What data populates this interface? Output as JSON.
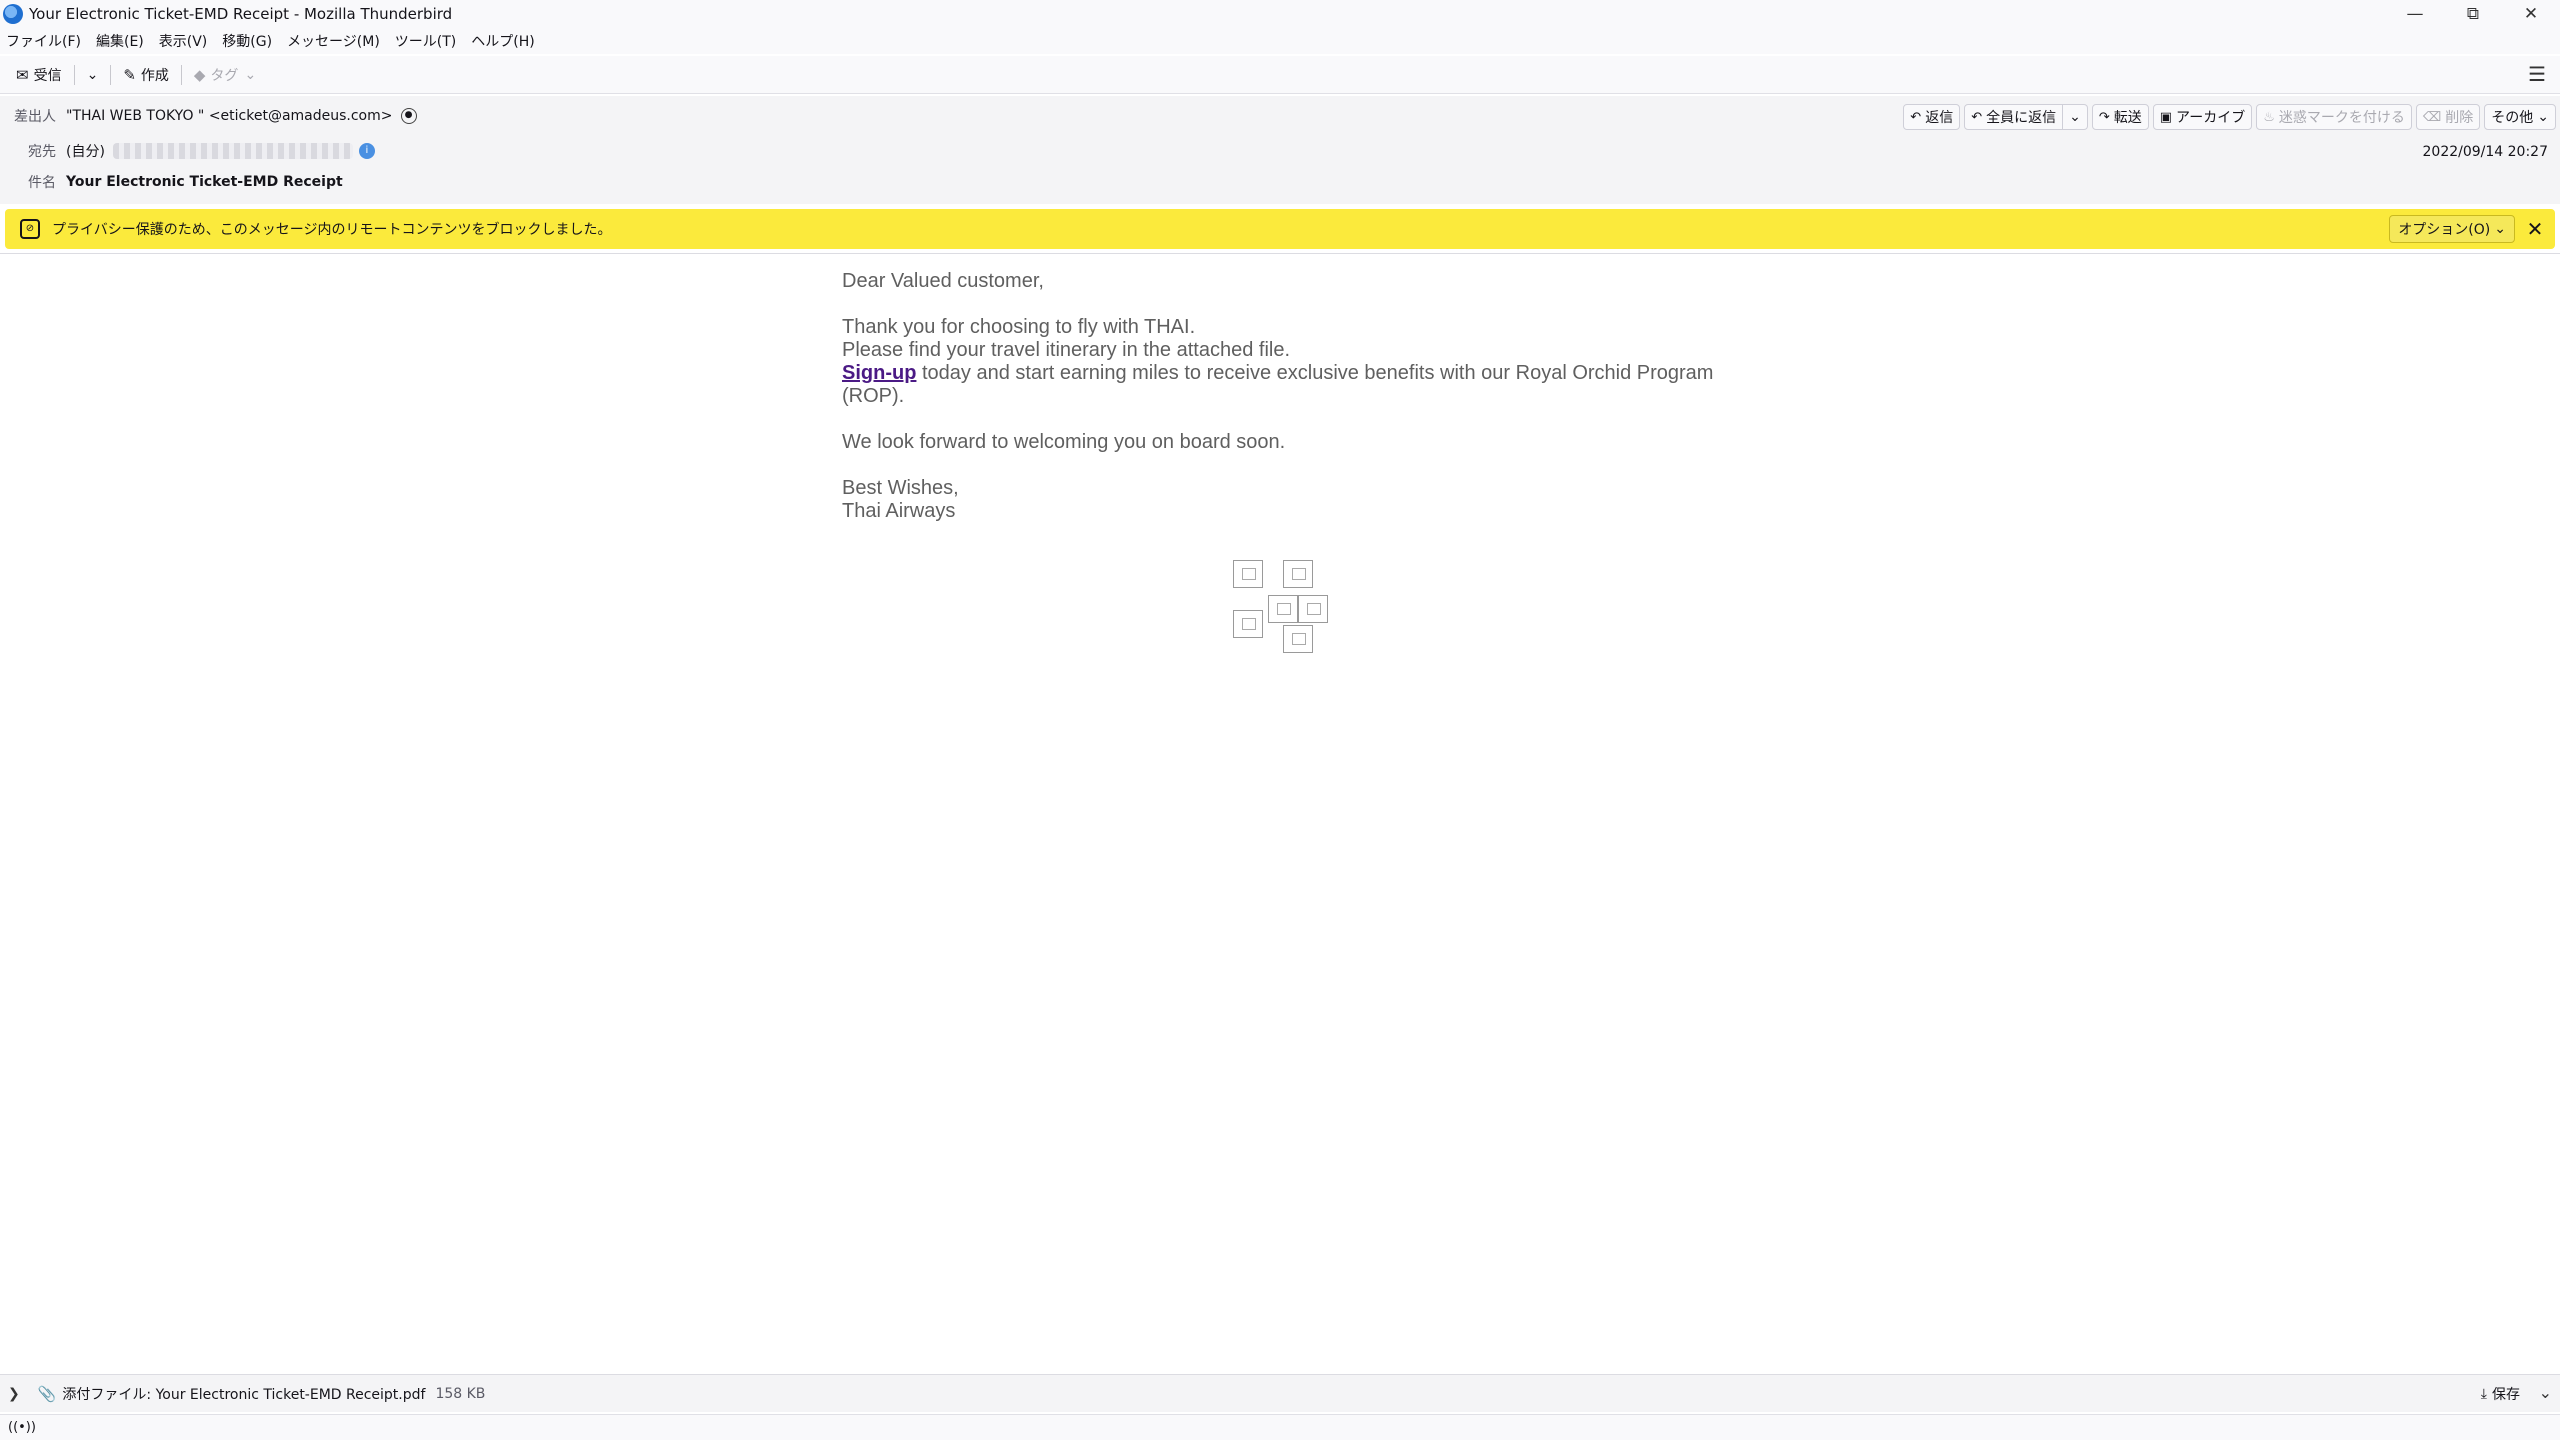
{
  "window": {
    "title": "Your Electronic Ticket-EMD Receipt - Mozilla Thunderbird"
  },
  "menu": [
    "ファイル(F)",
    "編集(E)",
    "表示(V)",
    "移動(G)",
    "メッセージ(M)",
    "ツール(T)",
    "ヘルプ(H)"
  ],
  "toolbar": {
    "get_mail": "受信",
    "write": "作成",
    "tag": "タグ"
  },
  "header": {
    "from_label": "差出人",
    "from_value": "\"THAI WEB TOKYO \" <eticket@amadeus.com>",
    "to_label": "宛先",
    "to_self": "(自分)",
    "subject_label": "件名",
    "subject_value": "Your Electronic Ticket-EMD Receipt",
    "date": "2022/09/14 20:27"
  },
  "actions": {
    "reply": "返信",
    "reply_all": "全員に返信",
    "forward": "転送",
    "archive": "アーカイブ",
    "junk": "迷惑マークを付ける",
    "delete": "削除",
    "more": "その他"
  },
  "notice": {
    "text": "プライバシー保護のため、このメッセージ内のリモートコンテンツをブロックしました。",
    "options": "オプション(O)"
  },
  "body": {
    "greeting": "Dear Valued customer,",
    "line1": "Thank you for choosing to fly with THAI.",
    "line2": "Please find your travel itinerary in the attached file.",
    "signup_link": "Sign-up",
    "line3_rest": " today and start earning miles to receive exclusive benefits with our Royal Orchid Program",
    "line3_end": "(ROP).",
    "line4": "We look forward to welcoming you on board soon.",
    "closing1": "Best Wishes,",
    "closing2": "Thai Airways"
  },
  "attachment": {
    "label": "添付ファイル: Your Electronic Ticket-EMD Receipt.pdf",
    "size": "158 KB",
    "save": "保存"
  },
  "icons": {
    "app": "thunderbird-icon",
    "accent": "#fbea3c",
    "link_color": "#4b1a85"
  }
}
